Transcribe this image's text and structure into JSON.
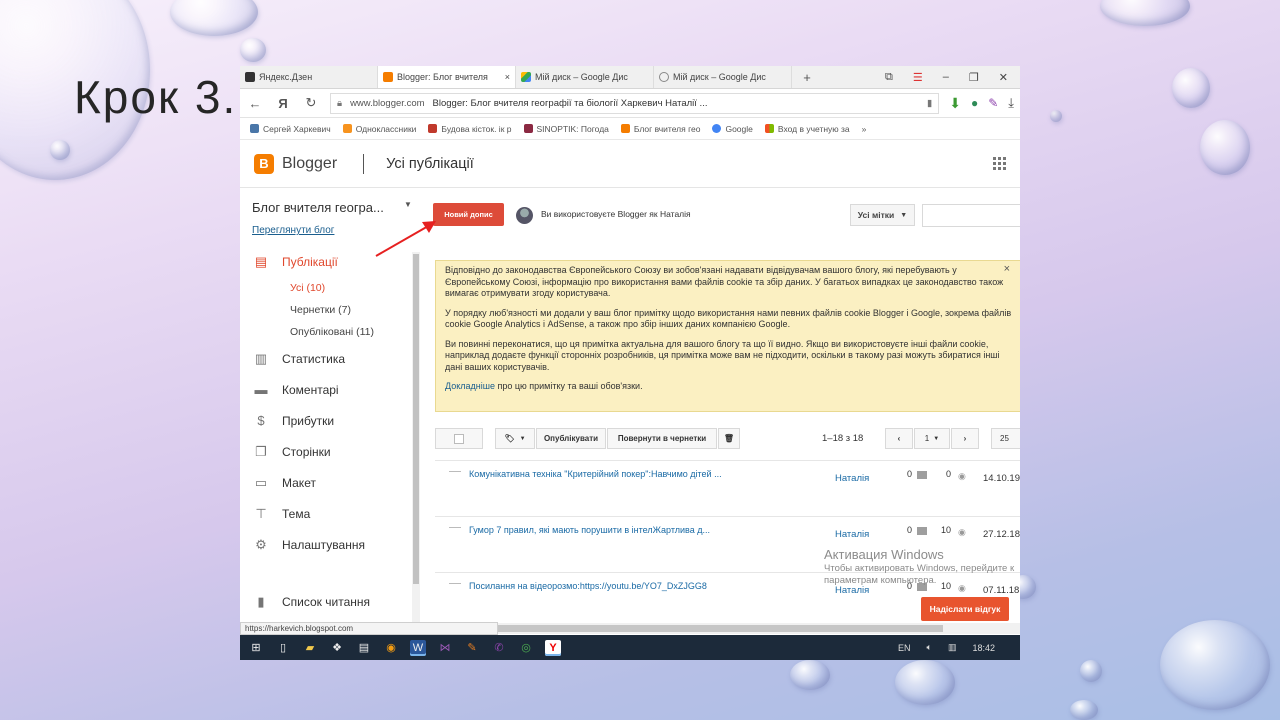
{
  "slide": {
    "title": "Крок 3."
  },
  "browser": {
    "tabs": [
      {
        "label": "Яндекс.Дзен",
        "color": "#333333",
        "active": false
      },
      {
        "label": "Blogger: Блог вчителя",
        "color": "#f57d00",
        "active": true
      },
      {
        "label": "Мій диск – Google Дис",
        "color": "#34a853",
        "active": false
      },
      {
        "label": "Мій диск – Google Дис",
        "color": "#888888",
        "active": false
      }
    ],
    "tab_close": "×",
    "new_tab": "+",
    "url_domain": "www.blogger.com",
    "url_title": "Blogger: Блог вчителя географії та біології Харкевич Наталії ...",
    "bookmarks": [
      {
        "label": "Сергей Харкевич",
        "color": "#4a76a8"
      },
      {
        "label": "Одноклассники",
        "color": "#f7931e"
      },
      {
        "label": "Будова кісток. ік р",
        "color": "#c0392b"
      },
      {
        "label": "SINOPTIK: Погода",
        "color": "#8b2942"
      },
      {
        "label": "Блог вчителя гео",
        "color": "#f57d00"
      },
      {
        "label": "Google",
        "color": "#4285f4"
      },
      {
        "label": "Вход в учетную за",
        "color": "#e74c3c"
      }
    ],
    "bookmarks_more": "»"
  },
  "blogger": {
    "logo_letter": "B",
    "brand": "Blogger",
    "section": "Усі публікації",
    "blog_name": "Блог вчителя геогра...",
    "view_blog": "Переглянути блог",
    "menu": [
      {
        "label": "Публікації",
        "icon": "posts-icon"
      },
      {
        "label": "Статистика",
        "icon": "stats-icon"
      },
      {
        "label": "Коментарі",
        "icon": "comments-icon"
      },
      {
        "label": "Прибутки",
        "icon": "earnings-icon"
      },
      {
        "label": "Сторінки",
        "icon": "pages-icon"
      },
      {
        "label": "Макет",
        "icon": "layout-icon"
      },
      {
        "label": "Тема",
        "icon": "theme-icon"
      },
      {
        "label": "Налаштування",
        "icon": "settings-icon"
      }
    ],
    "submenu": [
      {
        "label": "Усі (10)"
      },
      {
        "label": "Чернетки (7)"
      },
      {
        "label": "Опубліковані (11)"
      }
    ],
    "reading_list": "Список читання",
    "new_post": "Новий допис",
    "user_info": "Ви використовуєте Blogger як Наталія",
    "labels_button": "Усі мітки",
    "notice": {
      "p1": "Відповідно до законодавства Європейського Союзу ви зобов'язані надавати відвідувачам вашого блогу, які перебувають у Європейському Союзі, інформацію про використання вами файлів cookie та збір даних. У багатьох випадках це законодавство також вимагає отримувати згоду користувача.",
      "p2": "У порядку люб'язності ми додали у ваш блог примітку щодо використання нами певних файлів cookie Blogger і Google, зокрема файлів cookie Google Analytics і AdSense, а також про збір інших даних компанією Google.",
      "p3": "Ви повинні переконатися, що ця примітка актуальна для вашого блогу та що її видно. Якщо ви використовуєте інші файли cookie, наприклад додаєте функції сторонніх розробників, ця примітка може вам не підходити, оскільки в такому разі можуть збиратися інші дані ваших користувачів.",
      "link": "Докладніше",
      "tail": "про цю примітку та ваші обов'язки.",
      "close": "×"
    },
    "toolbar": {
      "publish": "Опублікувати",
      "revert": "Повернути в чернетки",
      "count": "1–18 з 18",
      "page": "1",
      "per_page": "25"
    },
    "posts": [
      {
        "title": "Комунікативна техніка \"Критерійний покер\":Навчимо дітей ...",
        "author": "Наталія",
        "comments": "0",
        "views": "0",
        "date": "14.10.19"
      },
      {
        "title": "Гумор 7 правил, які мають порушити в інтелЖартлива д...",
        "author": "Наталія",
        "comments": "0",
        "views": "10",
        "date": "27.12.18"
      },
      {
        "title": "Посилання на відеорозмо:https://youtu.be/YO7_DxZJGG8",
        "author": "Наталія",
        "comments": "0",
        "views": "10",
        "date": "07.11.18"
      }
    ],
    "feedback": "Надіслати відгук"
  },
  "status_url": "https://harkevich.blogspot.com",
  "windows": {
    "activate_title": "Активация Windows",
    "activate_text": "Чтобы активировать Windows, перейдите к параметрам компьютера.",
    "lang": "EN",
    "time": "18:42"
  },
  "colors": {
    "accent": "#dd4b39",
    "brand": "#f57d00",
    "link": "#1a5e8e",
    "notice_bg": "#fbf0c2"
  }
}
